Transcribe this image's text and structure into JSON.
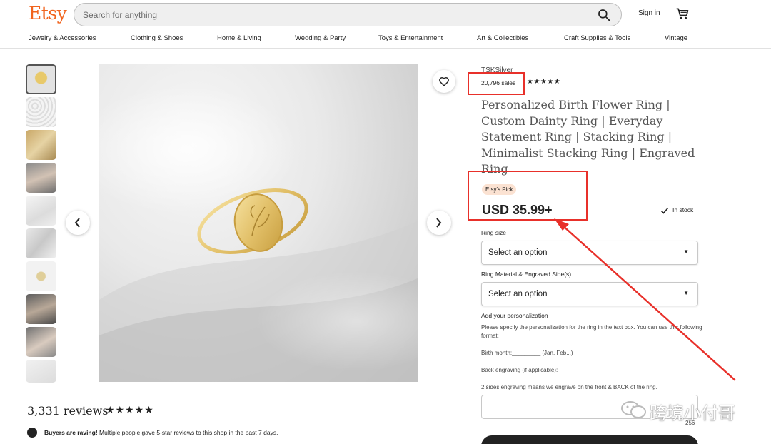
{
  "header": {
    "logo": "Etsy",
    "search_placeholder": "Search for anything",
    "signin": "Sign in"
  },
  "nav": {
    "items": [
      "Jewelry & Accessories",
      "Clothing & Shoes",
      "Home & Living",
      "Wedding & Party",
      "Toys & Entertainment",
      "Art & Collectibles",
      "Craft Supplies & Tools",
      "Vintage"
    ]
  },
  "listing": {
    "shop_name": "TSKSilver",
    "sales": "20,796 sales",
    "shop_stars": "★★★★★",
    "title": "Personalized Birth Flower Ring | Custom Dainty Ring | Everyday Statement Ring | Stacking Ring | Minimalist Stacking Ring | Engraved Ring",
    "badge": "Etsy's Pick",
    "price": "USD 35.99+",
    "stock": "In stock",
    "ring_size_label": "Ring size",
    "ring_size_value": "Select an option",
    "material_label": "Ring Material & Engraved Side(s)",
    "material_value": "Select an option",
    "personalization_title": "Add your personalization",
    "personalization_instructions": "Please specify the personalization for the ring in the text box. You can use this following format:",
    "birth_month": "Birth month:_________ (Jan, Feb...)",
    "back_engraving": "Back engraving (if applicable):_________",
    "two_sides": "2 sides engraving means we engrave on the front & BACK of the ring.",
    "char_counter": "256"
  },
  "reviews": {
    "count": "3,331 reviews",
    "stars": "★★★★★",
    "raving_bold": "Buyers are raving!",
    "raving_text": " Multiple people gave 5-star reviews to this shop in the past 7 days."
  },
  "watermark": {
    "text": "跨境小付哥"
  },
  "colors": {
    "brand": "#f1641e",
    "annotation": "#e8302a",
    "badge_bg": "#fbe2d2"
  }
}
